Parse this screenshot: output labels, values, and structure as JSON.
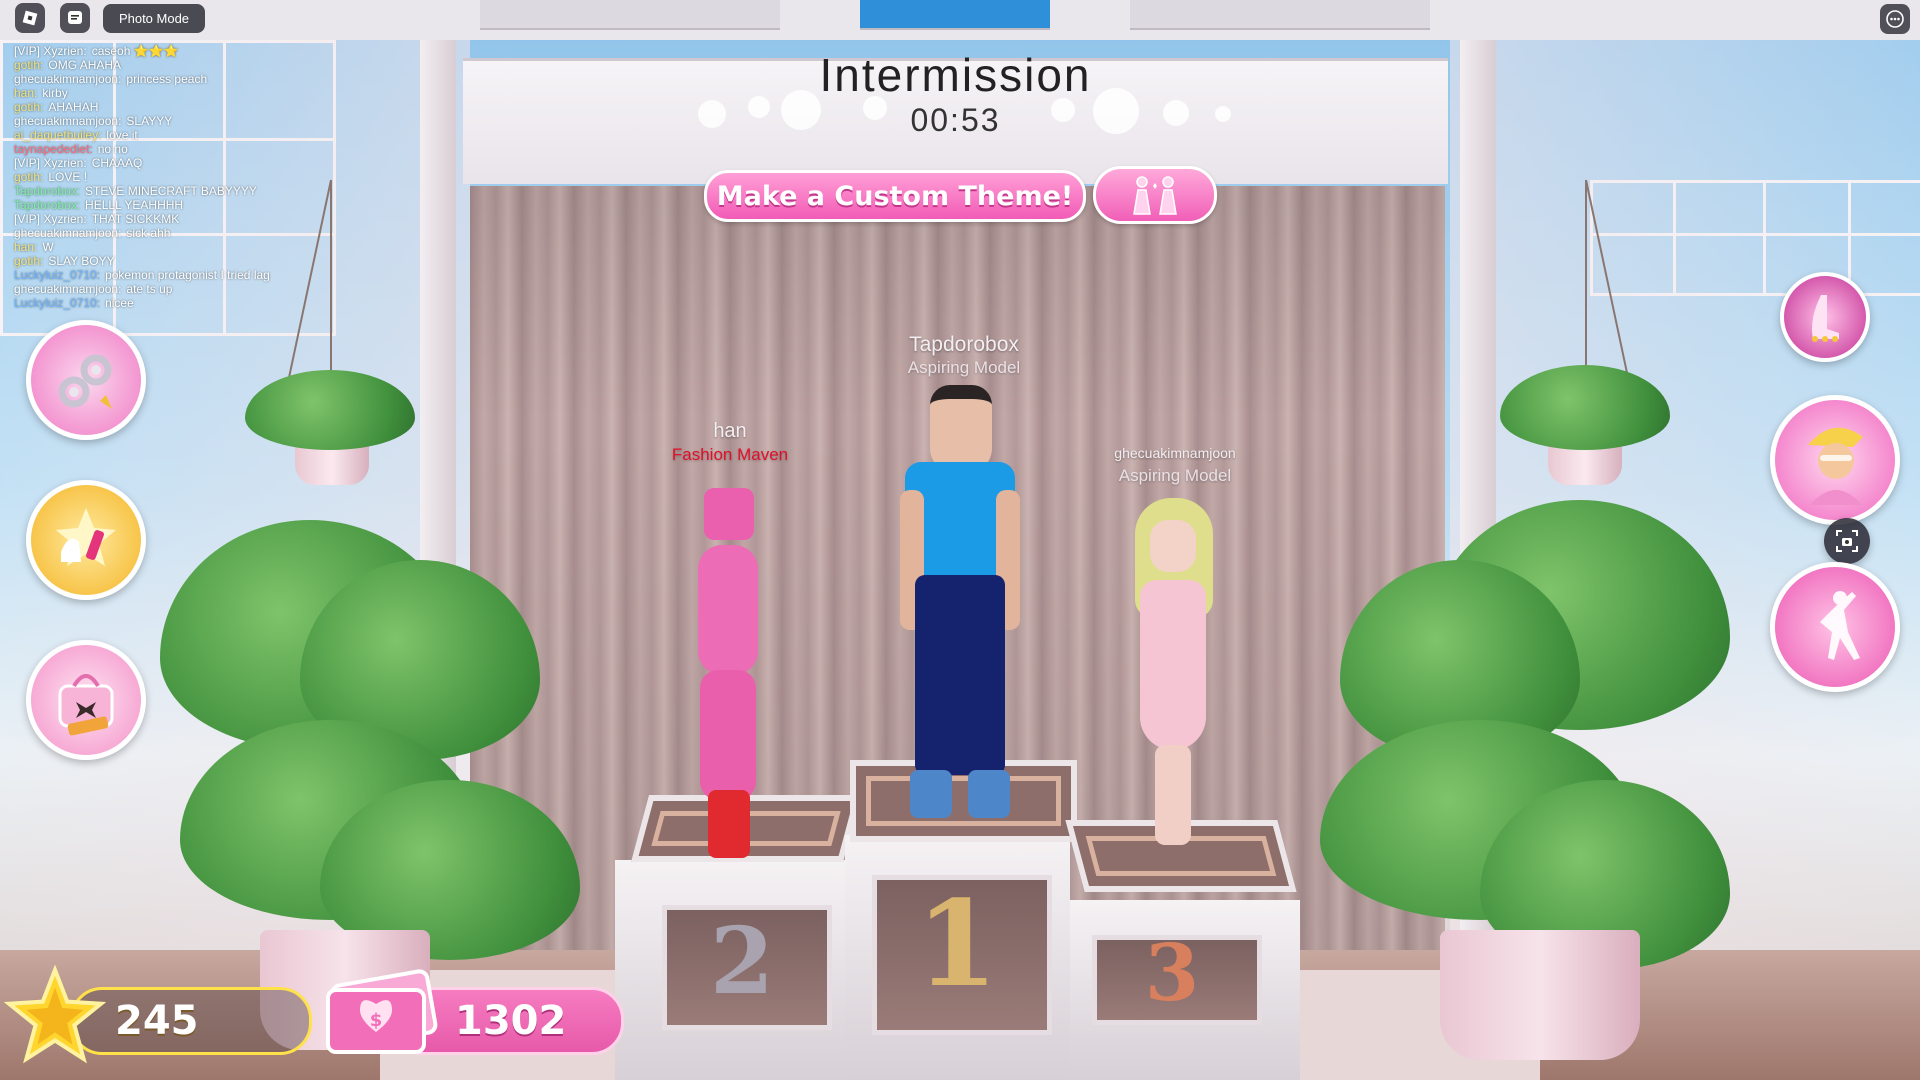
{
  "topbar": {
    "photo_mode_label": "Photo Mode"
  },
  "chat": [
    {
      "user": "[VIP] Xyzrien:",
      "color": "#ffffff",
      "text": "caseoh ⭐⭐⭐"
    },
    {
      "user": "gotih:",
      "color": "#f2e27a",
      "text": "OMG AHAHA"
    },
    {
      "user": "ghecuakimnamjoon:",
      "color": "#ffffff",
      "text": "princess peach"
    },
    {
      "user": "han:",
      "color": "#f2e27a",
      "text": "kirby"
    },
    {
      "user": "gotih:",
      "color": "#f2e27a",
      "text": "AHAHAH"
    },
    {
      "user": "ghecuakimnamjoon:",
      "color": "#ffffff",
      "text": "SLAYYY"
    },
    {
      "user": "ai_daquetbuiley:",
      "color": "#f2e27a",
      "text": "love it"
    },
    {
      "user": "taynapedediet:",
      "color": "#ff6a7a",
      "text": "no no"
    },
    {
      "user": "[VIP] Xyzrien:",
      "color": "#ffffff",
      "text": "CHAAAQ"
    },
    {
      "user": "gotih:",
      "color": "#f2e27a",
      "text": "LOVE !"
    },
    {
      "user": "Tapdorobox:",
      "color": "#7df0a0",
      "text": "STEVE MINECRAFT BABYYYY"
    },
    {
      "user": "Tapdorobox:",
      "color": "#7df0a0",
      "text": "HELLL YEAHHHH"
    },
    {
      "user": "[VIP] Xyzrien:",
      "color": "#ffffff",
      "text": "THAT SICKKMK"
    },
    {
      "user": "ghecuakimnamjoon:",
      "color": "#ffffff",
      "text": "sick ahh"
    },
    {
      "user": "han:",
      "color": "#f2e27a",
      "text": "W"
    },
    {
      "user": "gotih:",
      "color": "#f2e27a",
      "text": "SLAY BOYY"
    },
    {
      "user": "Luckyluiz_0710:",
      "color": "#6fb4ff",
      "text": "pokemon protagonist I tried lag"
    },
    {
      "user": "ghecuakimnamjoon:",
      "color": "#ffffff",
      "text": "ate ts up"
    },
    {
      "user": "Luckyluiz_0710:",
      "color": "#6fb4ff",
      "text": "nicee"
    }
  ],
  "intermission": {
    "title": "Intermission",
    "time": "00:53"
  },
  "theme_button_label": "Make a Custom Theme!",
  "podium": {
    "first": {
      "name": "Tapdorobox",
      "title": "Aspiring Model",
      "title_color": "#e9e1e6",
      "place": "1"
    },
    "second": {
      "name": "han",
      "title": "Fashion Maven",
      "title_color": "#e0102a",
      "place": "2"
    },
    "third": {
      "name": "ghecuakimnamjoon",
      "title": "Aspiring Model",
      "title_color": "#e9e1e6",
      "place": "3"
    }
  },
  "currency": {
    "stars": "245",
    "cash": "1302"
  },
  "icons": {
    "left_buttons": [
      "settings-icon",
      "outfit-icon",
      "codes-icon"
    ],
    "right_buttons": [
      "shoe-icon",
      "character-icon",
      "screenshot-icon",
      "pose-icon"
    ]
  },
  "colors": {
    "accent_pink": "#f25bb6",
    "star_gold": "#ffe24a"
  }
}
